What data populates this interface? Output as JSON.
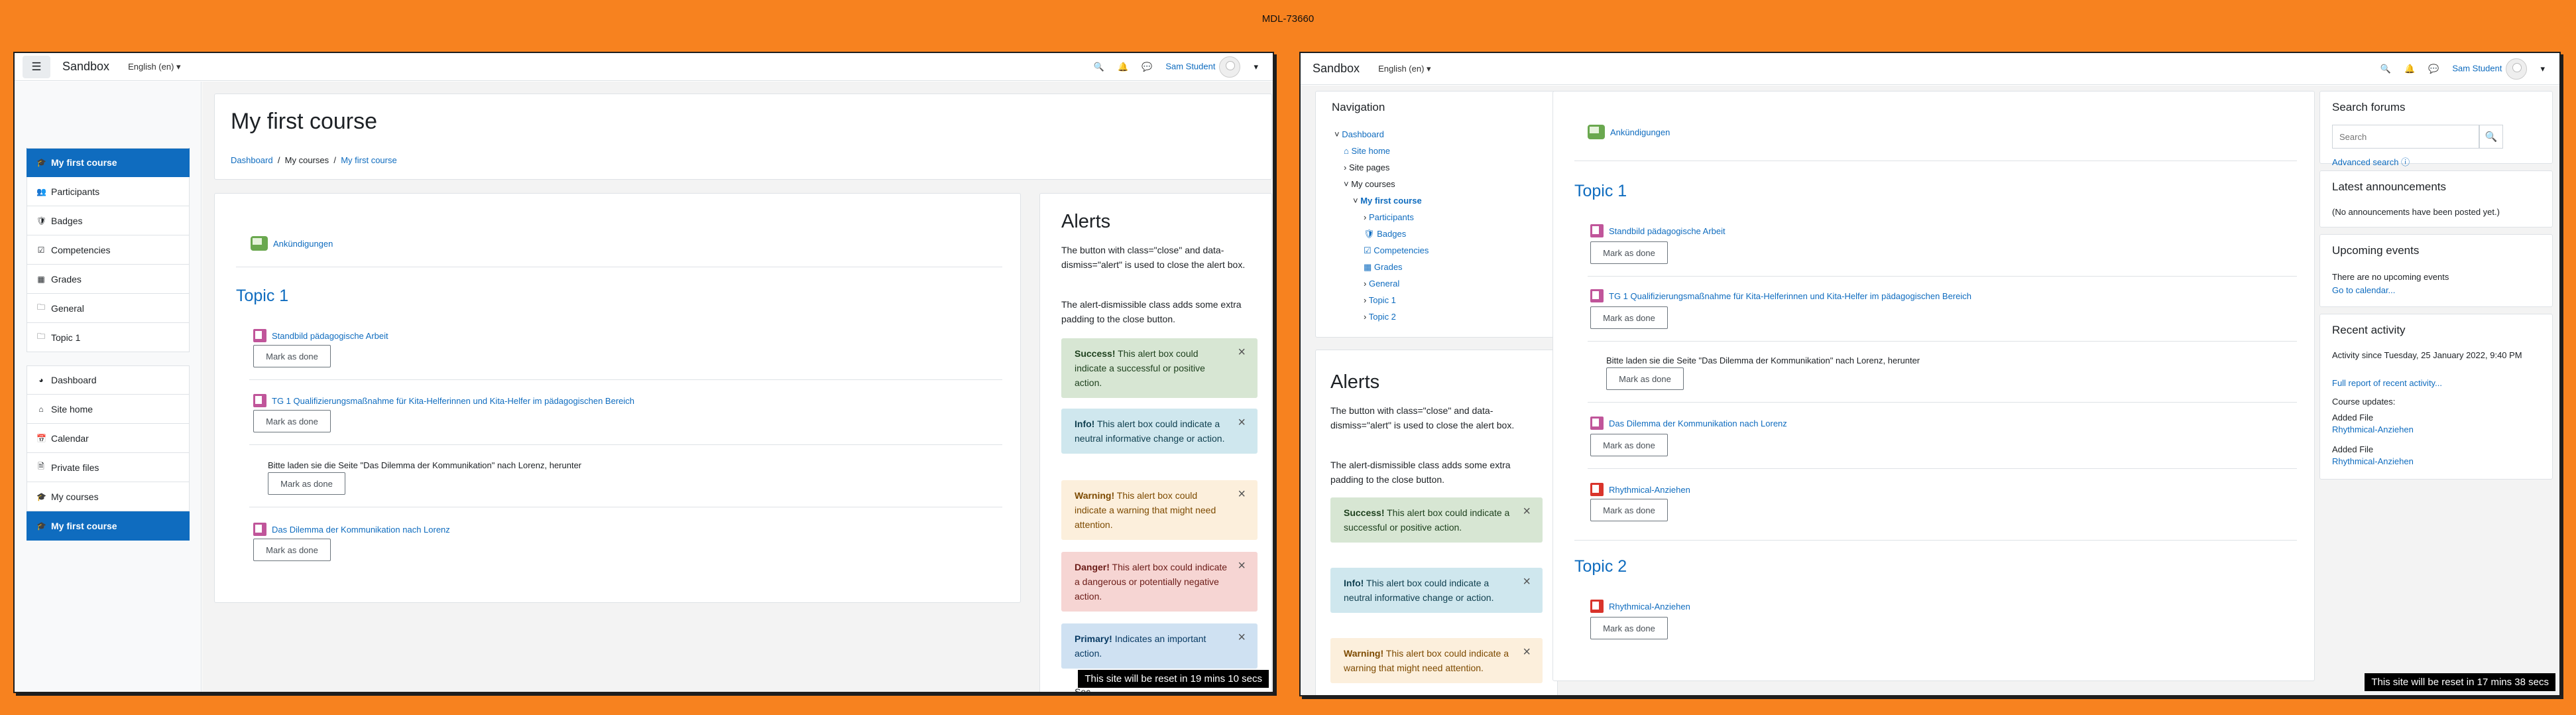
{
  "banner": "MDL-73660",
  "w1": {
    "brand": "Sandbox",
    "lang": "English (en) ▾",
    "user": "Sam Student",
    "drawer": [
      "My first course",
      "Participants",
      "Badges",
      "Competencies",
      "Grades",
      "General",
      "Topic 1",
      "Dashboard",
      "Site home",
      "Calendar",
      "Private files",
      "My courses",
      "My first course"
    ],
    "title": "My first course",
    "crumb": {
      "a": "Dashboard",
      "b": "My courses",
      "c": "My first course"
    },
    "forum": "Ankündigungen",
    "topic": "Topic 1",
    "acts": [
      "Standbild pädagogische Arbeit",
      "TG 1 Qualifizierungsmaßnahme für Kita-Helferinnen und Kita-Helfer im pädagogischen Bereich",
      "Das Dilemma der Kommunikation nach Lorenz"
    ],
    "label": "Bitte laden sie die Seite \"Das Dilemma der Kommunikation\" nach Lorenz, herunter",
    "done": "Mark as done",
    "alerts_title": "Alerts",
    "p1": "The button with class=\"close\" and data-dismiss=\"alert\" is used to close the alert box.",
    "p2": "The alert-dismissible class adds some extra padding to the close button.",
    "al": [
      {
        "b": "Success!",
        "t": " This alert box could indicate a successful or positive action."
      },
      {
        "b": "Info!",
        "t": " This alert box could indicate a neutral informative change or action."
      },
      {
        "b": "Warning!",
        "t": " This alert box could indicate a warning that might need attention."
      },
      {
        "b": "Danger!",
        "t": " This alert box could indicate a dangerous or potentially negative action."
      },
      {
        "b": "Primary!",
        "t": " Indicates an important action."
      }
    ],
    "sec_partial": "Sec",
    "reset": "This site will be reset in 19 mins 10 secs"
  },
  "w2": {
    "brand": "Sandbox",
    "lang": "English (en) ▾",
    "user": "Sam Student",
    "nav_title": "Navigation",
    "tree": [
      "Dashboard",
      "Site home",
      "Site pages",
      "My courses",
      "My first course",
      "Participants",
      "Badges",
      "Competencies",
      "Grades",
      "General",
      "Topic 1",
      "Topic 2"
    ],
    "alerts_title": "Alerts",
    "p1": "The button with class=\"close\" and data-dismiss=\"alert\" is used to close the alert box.",
    "p2": "The alert-dismissible class adds some extra padding to the close button.",
    "al": [
      {
        "b": "Success!",
        "t": " This alert box could indicate a successful or positive action."
      },
      {
        "b": "Info!",
        "t": " This alert box could indicate a neutral informative change or action."
      },
      {
        "b": "Warning!",
        "t": " This alert box could indicate a warning that might need attention."
      }
    ],
    "forum": "Ankündigungen",
    "topic1": "Topic 1",
    "topic2": "Topic 2",
    "acts": [
      "Standbild pädagogische Arbeit",
      "TG 1 Qualifizierungsmaßnahme für Kita-Helferinnen und Kita-Helfer im pädagogischen Bereich",
      "Das Dilemma der Kommunikation nach Lorenz",
      "Rhythmical-Anziehen",
      "Rhythmical-Anziehen"
    ],
    "label": "Bitte laden sie die Seite \"Das Dilemma der Kommunikation\" nach Lorenz, herunter",
    "done": "Mark as done",
    "search_title": "Search forums",
    "search_ph": "Search",
    "adv": "Advanced search",
    "ann_title": "Latest announcements",
    "ann_txt": "(No announcements have been posted yet.)",
    "up_title": "Upcoming events",
    "up_txt": "There are no upcoming events",
    "up_link": "Go to calendar...",
    "ra_title": "Recent activity",
    "ra_since": "Activity since Tuesday, 25 January 2022, 9:40 PM",
    "ra_full": "Full report of recent activity...",
    "ra_upd": "Course updates:",
    "ra_added": "Added File",
    "ra_file": "Rhythmical-Anziehen",
    "reset": "This site will be reset in 17 mins 38 secs"
  }
}
